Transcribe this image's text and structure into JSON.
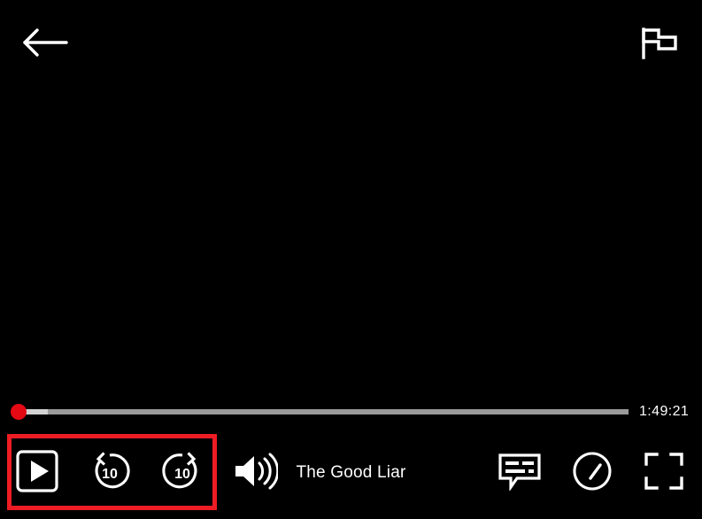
{
  "player": {
    "background_color": "#000000",
    "accent_color": "#e50914",
    "highlight_color": "#ed1c24"
  },
  "top_bar": {
    "back_button": {
      "name": "back",
      "icon": "arrow-left-icon",
      "label": "Back"
    },
    "flag_button": {
      "name": "flag",
      "icon": "flag-icon",
      "label": "Flag"
    }
  },
  "progress": {
    "played_percent": 1,
    "buffered_percent": 6,
    "thumb_position_percent": 1,
    "remaining_time": "1:49:21"
  },
  "controls": {
    "play": {
      "label": "Play",
      "icon": "play-icon"
    },
    "rewind": {
      "label": "Rewind",
      "icon": "rewind-10-icon",
      "seconds": "10"
    },
    "forward": {
      "label": "Forward",
      "icon": "forward-10-icon",
      "seconds": "10"
    },
    "volume": {
      "label": "Volume",
      "icon": "volume-high-icon"
    },
    "subtitles": {
      "label": "Subtitles",
      "icon": "subtitles-icon"
    },
    "speed": {
      "label": "Playback speed",
      "icon": "speedometer-icon"
    },
    "fullscreen": {
      "label": "Fullscreen",
      "icon": "fullscreen-icon"
    }
  },
  "title": "The Good Liar"
}
